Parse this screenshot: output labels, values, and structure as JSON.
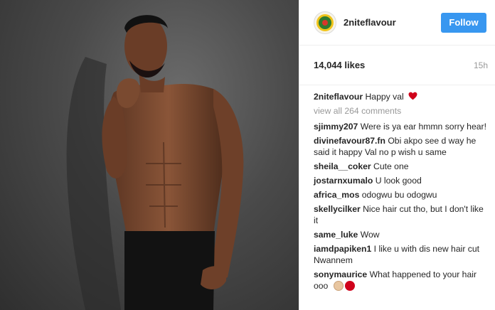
{
  "post": {
    "username": "2niteflavour",
    "follow_label": "Follow",
    "likes": "14,044 likes",
    "time": "15h",
    "caption_user": "2niteflavour",
    "caption_text": "Happy val",
    "view_all": "view all 264 comments"
  },
  "comments": [
    {
      "user": "sjimmy207",
      "text": "Were is ya ear hmmn sorry hear!"
    },
    {
      "user": "divinefavour87.fn",
      "text": "Obi akpo see d way he said it happy Val no p wish u same"
    },
    {
      "user": "sheila__coker",
      "text": "Cute one"
    },
    {
      "user": "jostarnxumalo",
      "text": "U look good"
    },
    {
      "user": "africa_mos",
      "text": "odogwu bu odogwu"
    },
    {
      "user": "skellycilker",
      "text": "Nice hair cut tho, but I don't like it"
    },
    {
      "user": "same_luke",
      "text": "Wow"
    },
    {
      "user": "iamdpapiken1",
      "text": "I like u with dis new hair cut Nwannem"
    },
    {
      "user": "sonymaurice",
      "text": "What happened to your hair ooo"
    }
  ],
  "colors": {
    "accent": "#3897f0",
    "heart": "#d0021b"
  },
  "icons": {
    "heart": "heart-icon",
    "avatar": "profile-avatar"
  }
}
